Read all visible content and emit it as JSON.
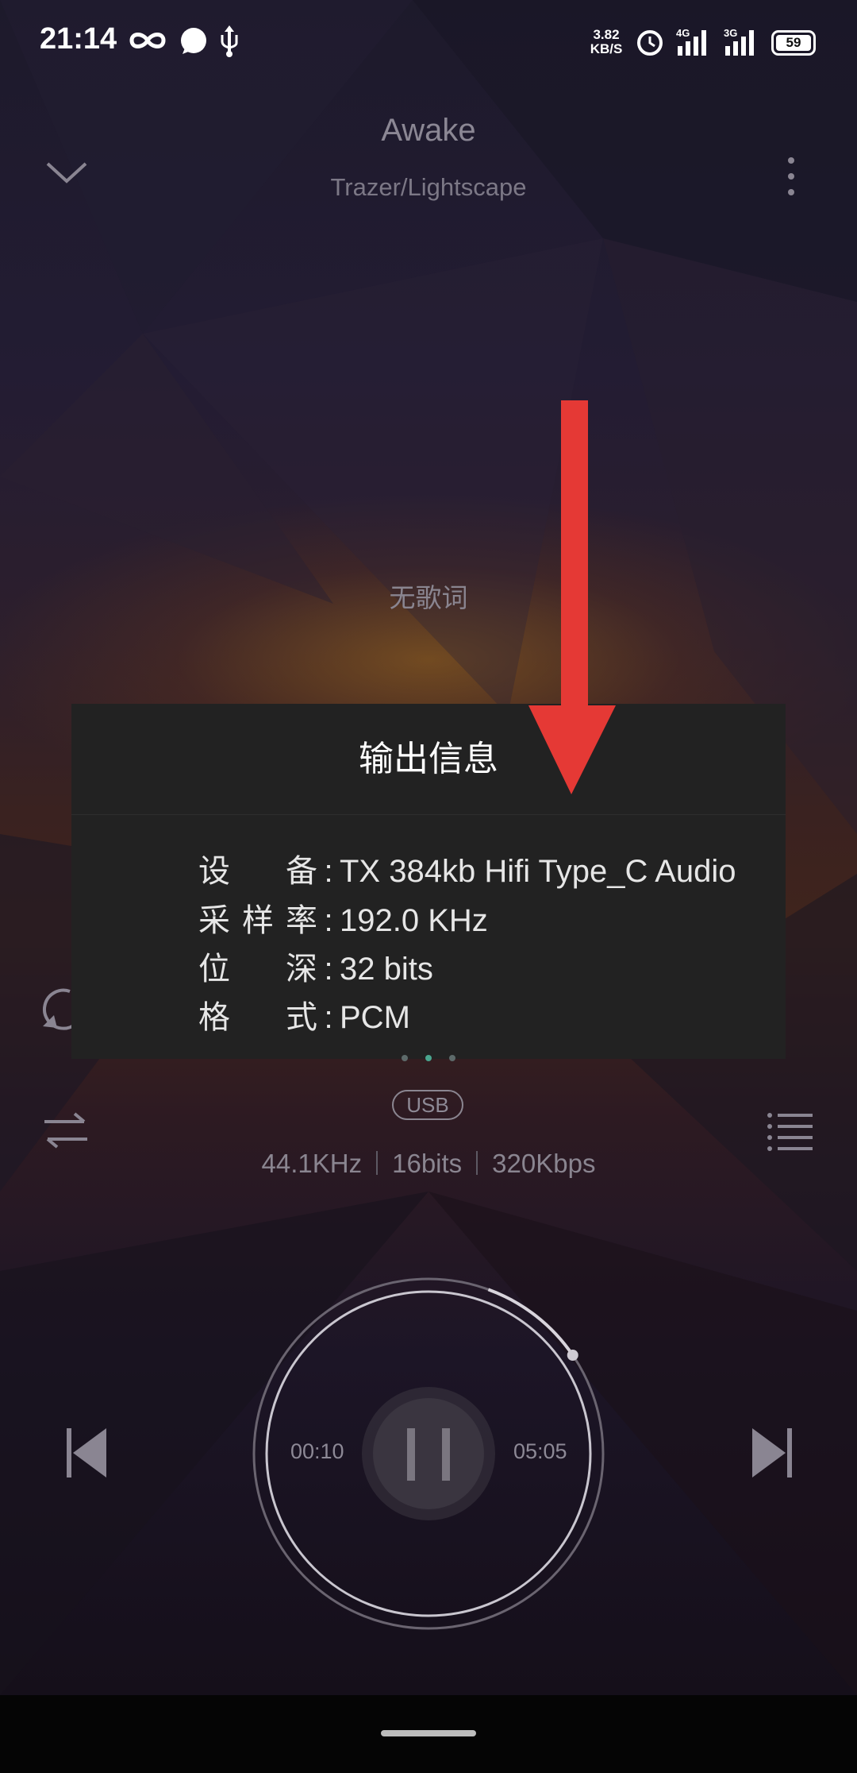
{
  "status_bar": {
    "time": "21:14",
    "net_speed_value": "3.82",
    "net_speed_unit": "KB/S",
    "signal_1_type": "4G",
    "signal_2_type": "3G",
    "battery": "59"
  },
  "player": {
    "title": "Awake",
    "artist": "Trazer/Lightscape",
    "lyrics_placeholder": "无歌词",
    "output_badge": "USB",
    "sample_rate": "44.1KHz",
    "bit_depth": "16bits",
    "bitrate": "320Kbps",
    "elapsed": "00:10",
    "duration": "05:05",
    "progress_fraction": 0.033
  },
  "dialog": {
    "title": "输出信息",
    "rows": [
      {
        "label": "设备",
        "value": "TX 384kb Hifi Type_C Audio"
      },
      {
        "label": "采样率",
        "value": "192.0 KHz"
      },
      {
        "label": "位深",
        "value": "32 bits"
      },
      {
        "label": "格式",
        "value": "PCM"
      }
    ],
    "separator": ":"
  },
  "colors": {
    "annotation_arrow": "#e53935",
    "dialog_bg": "#222222",
    "text_muted": "#8a8590"
  },
  "icons": [
    "collapse-chevron-icon",
    "more-vertical-icon",
    "repeat-icon",
    "shuffle-icon",
    "playlist-icon",
    "previous-icon",
    "pause-icon",
    "next-icon",
    "infinity-icon",
    "chat-bubble-icon",
    "usb-icon",
    "alarm-icon",
    "signal-icon"
  ]
}
